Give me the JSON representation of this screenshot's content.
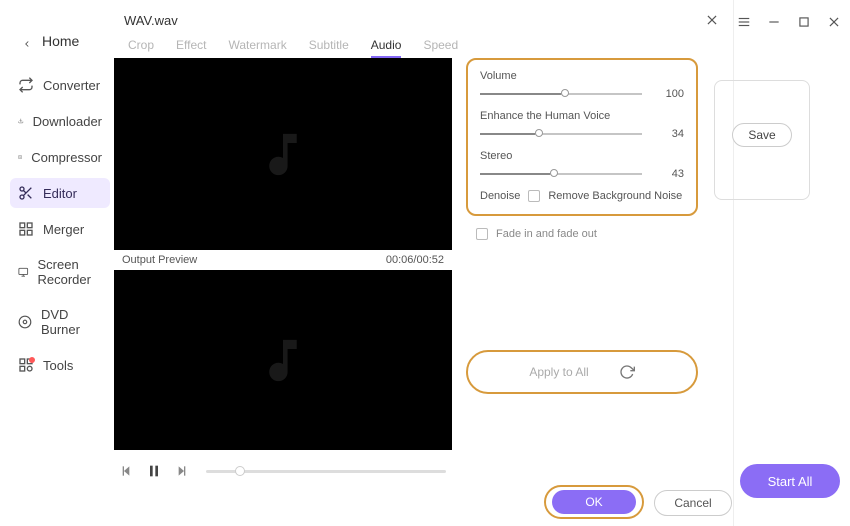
{
  "main": {
    "home": "Home",
    "titlebar": {
      "menu": "menu",
      "min": "minimize",
      "max": "maximize",
      "close": "close"
    }
  },
  "sidebar": {
    "items": [
      {
        "label": "Converter",
        "icon": "converter-icon"
      },
      {
        "label": "Downloader",
        "icon": "downloader-icon"
      },
      {
        "label": "Compressor",
        "icon": "compressor-icon"
      },
      {
        "label": "Editor",
        "icon": "editor-icon"
      },
      {
        "label": "Merger",
        "icon": "merger-icon"
      },
      {
        "label": "Screen Recorder",
        "icon": "recorder-icon"
      },
      {
        "label": "DVD Burner",
        "icon": "dvd-icon"
      },
      {
        "label": "Tools",
        "icon": "tools-icon"
      }
    ],
    "active_index": 3
  },
  "modal": {
    "title": "WAV.wav",
    "tabs": [
      "Crop",
      "Effect",
      "Watermark",
      "Subtitle",
      "Audio",
      "Speed"
    ],
    "active_tab_index": 4,
    "preview_label": "Output Preview",
    "time": "00:06/00:52"
  },
  "audio": {
    "volume": {
      "label": "Volume",
      "value": 100
    },
    "enhance": {
      "label": "Enhance the Human Voice",
      "value": 34
    },
    "stereo": {
      "label": "Stereo",
      "value": 43
    },
    "denoise": {
      "label": "Denoise",
      "checkbox_label": "Remove Background Noise"
    },
    "fade": "Fade in and fade out"
  },
  "buttons": {
    "apply_all": "Apply to All",
    "ok": "OK",
    "cancel": "Cancel",
    "save": "Save",
    "start_all": "Start All"
  },
  "playback": {
    "progress_pct": 12
  },
  "colors": {
    "accent": "#8b6df5",
    "highlight_border": "#d79a3c"
  }
}
